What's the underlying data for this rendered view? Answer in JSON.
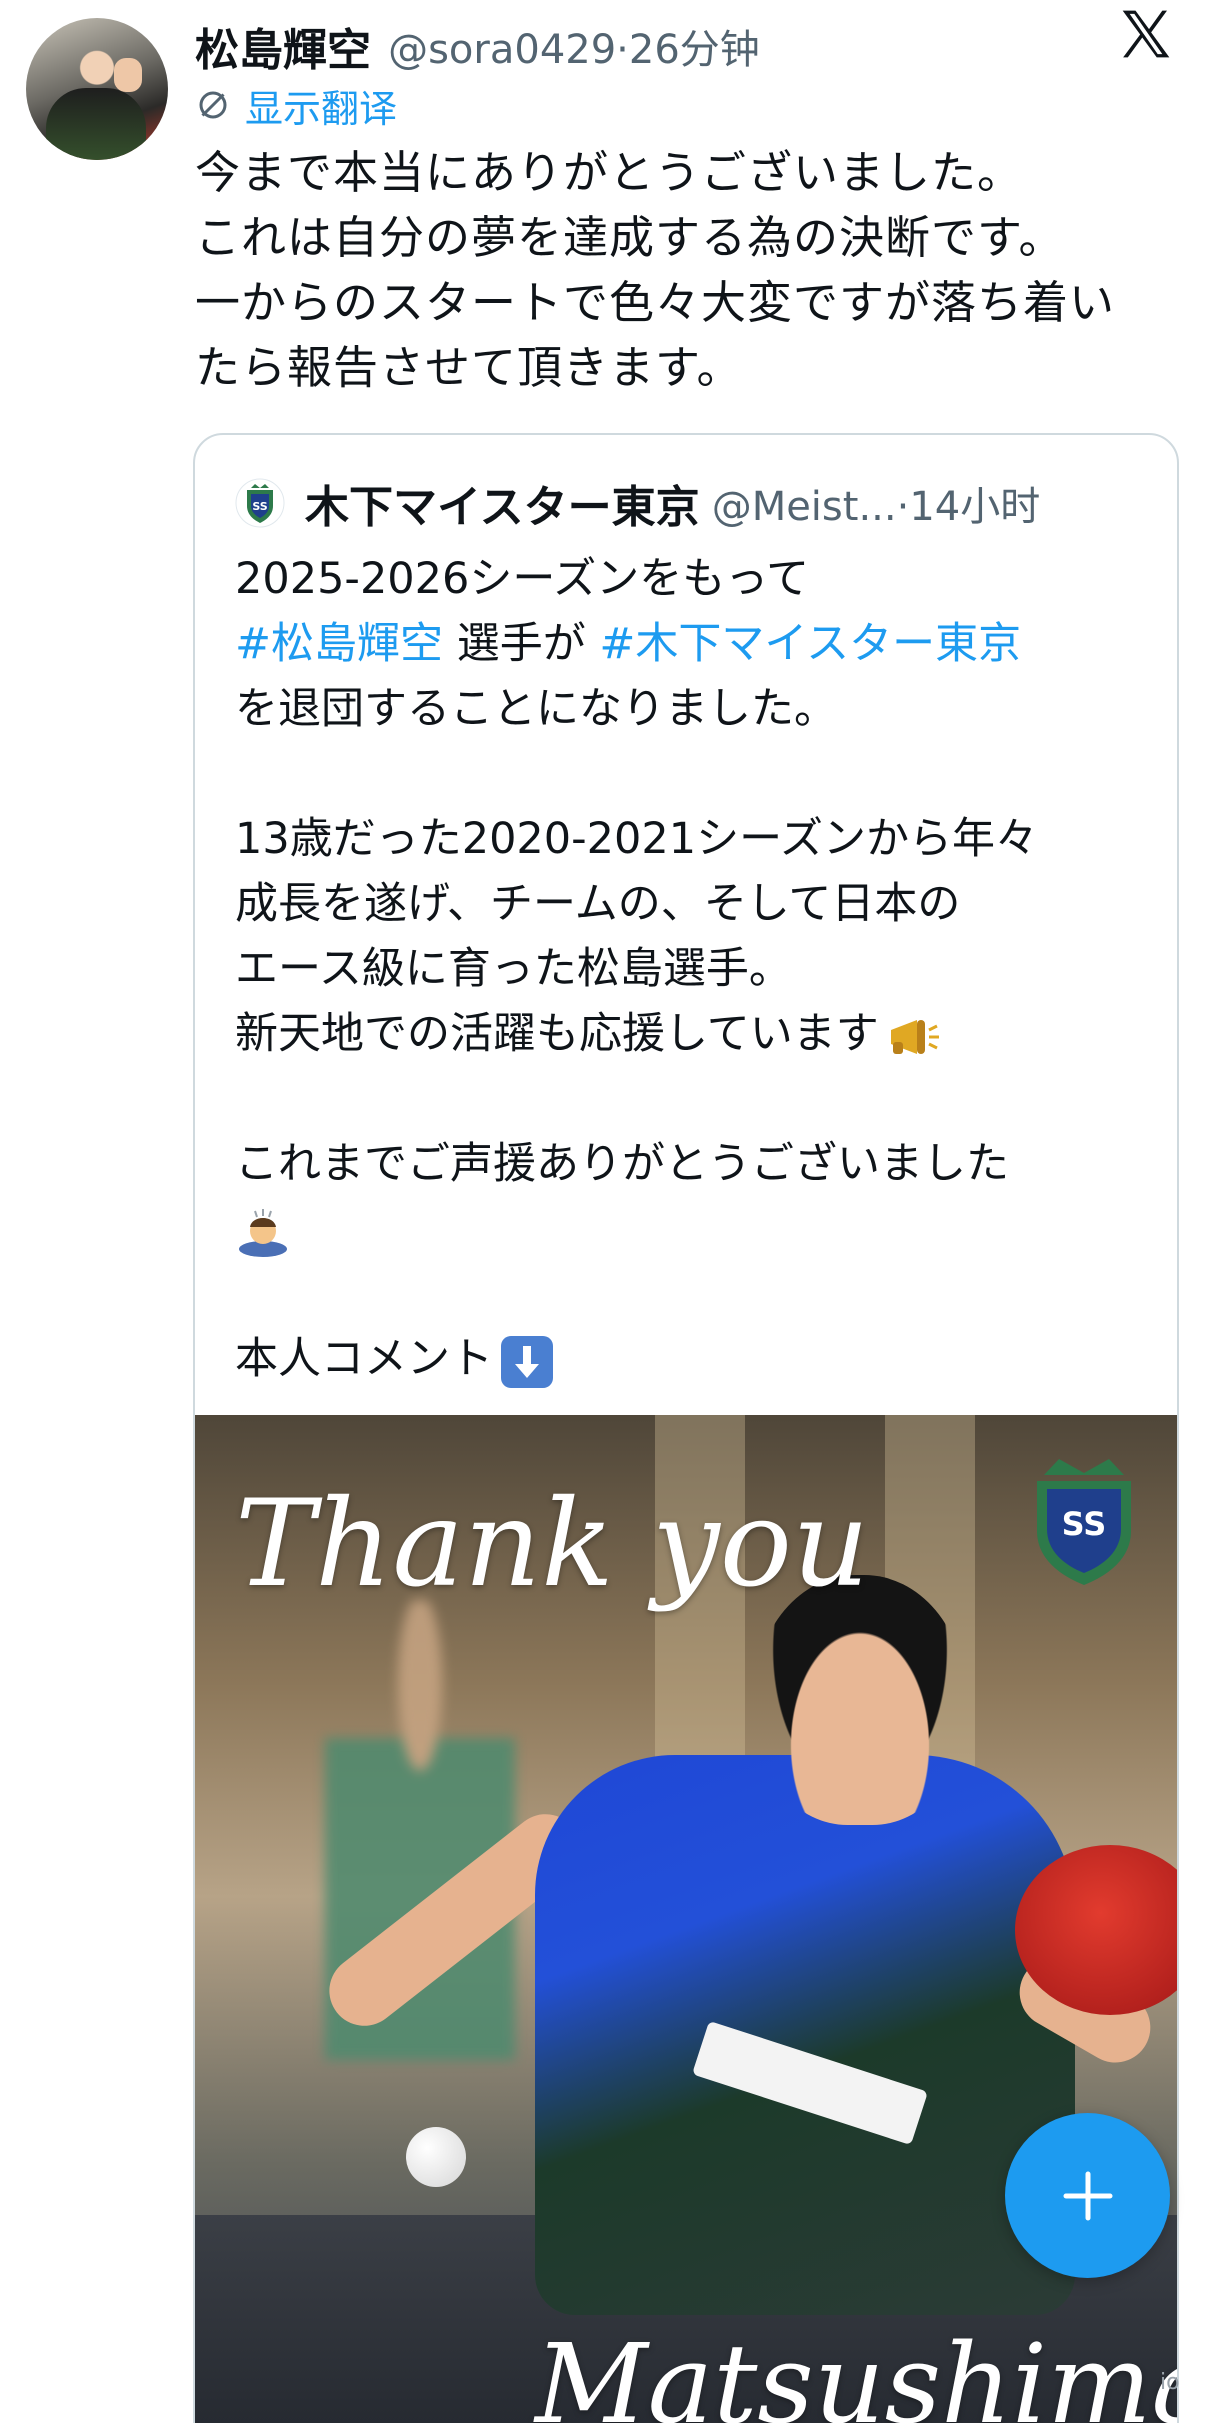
{
  "tweet": {
    "display_name": "松島輝空",
    "handle": "@sora0429",
    "separator": "·",
    "time": "26分钟",
    "translate_label": "显示翻译",
    "text_lines": [
      "今まで本当にありがとうございました。",
      "これは自分の夢を達成する為の決断です。",
      "一からのスタートで色々大変ですが落ち着い",
      "たら報告させて頂きます。"
    ]
  },
  "quote": {
    "display_name": "木下マイスター東京",
    "handle": "@Meist...",
    "separator": "·",
    "time": "14小时",
    "line1": "2025-2026シーズンをもって",
    "hashtag1": "#松島輝空",
    "line2_mid": " 選手が ",
    "hashtag2": "#木下マイスター東京",
    "line3": "を退団することになりました。",
    "line4": "13歳だった2020-2021シーズンから年々",
    "line5": "成長を遂げ、チームの、そして日本の",
    "line6": "エース級に育った松島選手。",
    "line7": "新天地での活躍も応援しています",
    "line8": "これまでご声援ありがとうございました",
    "line9": "本人コメント",
    "emoji_megaphone": "megaphone-icon",
    "emoji_bow": "person-bowing-icon",
    "emoji_down": "down-arrow-icon"
  },
  "photo": {
    "headline": "Thank you",
    "name": "Matsushima"
  },
  "fab": {
    "icon": "plus-icon"
  },
  "corner_mark": "io",
  "colors": {
    "link": "#1d9bf0",
    "text": "#0f1419",
    "muted": "#536471",
    "border": "#cfd9de"
  }
}
